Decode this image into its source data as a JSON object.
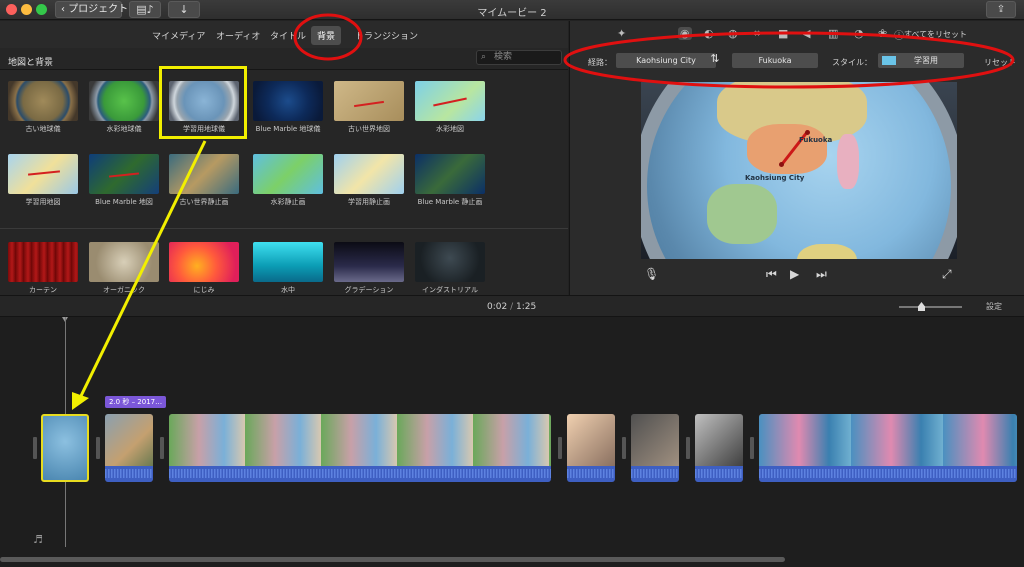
{
  "titlebar": {
    "back_label": "プロジェクト",
    "window_title": "マイムービー 2"
  },
  "tabs": [
    {
      "label": "マイメディア"
    },
    {
      "label": "オーディオ"
    },
    {
      "label": "タイトル"
    },
    {
      "label": "背景",
      "selected": true
    },
    {
      "label": "トランジション"
    }
  ],
  "browser": {
    "title": "地図と背景",
    "search_placeholder": "検索"
  },
  "items": [
    {
      "label": "古い地球儀"
    },
    {
      "label": "水彩地球儀"
    },
    {
      "label": "学習用地球儀",
      "selected": true
    },
    {
      "label": "Blue Marble 地球儀"
    },
    {
      "label": "古い世界地図"
    },
    {
      "label": "水彩地図"
    },
    {
      "label": "学習用地図"
    },
    {
      "label": "Blue Marble 地図"
    },
    {
      "label": "古い世界静止画"
    },
    {
      "label": "水彩静止画"
    },
    {
      "label": "学習用静止画"
    },
    {
      "label": "Blue Marble 静止画"
    },
    {
      "label": "カーテン"
    },
    {
      "label": "オーガニック"
    },
    {
      "label": "にじみ"
    },
    {
      "label": "水中"
    },
    {
      "label": "グラデーション"
    },
    {
      "label": "インダストリアル"
    }
  ],
  "viewer": {
    "reset_all_label": "すべてをリセット",
    "route_label": "経路：",
    "route_from": "Kaohsiung City",
    "route_to": "Fukuoka",
    "style_label": "スタイル：",
    "style_value": "学習用",
    "reset_label": "リセット",
    "map_labels": {
      "from": "Kaohsiung City",
      "to": "Fukuoka"
    }
  },
  "timeline": {
    "current_time": "0:02",
    "total_time": "1:25",
    "settings_label": "設定",
    "clip_duration_label": "2.0 秒 – 2017…"
  },
  "colors": {
    "accent_yellow": "#f2ef00",
    "annotation_red": "#e01010",
    "audio_blue": "#3e5fc2",
    "duration_purple": "#7b57d8"
  }
}
